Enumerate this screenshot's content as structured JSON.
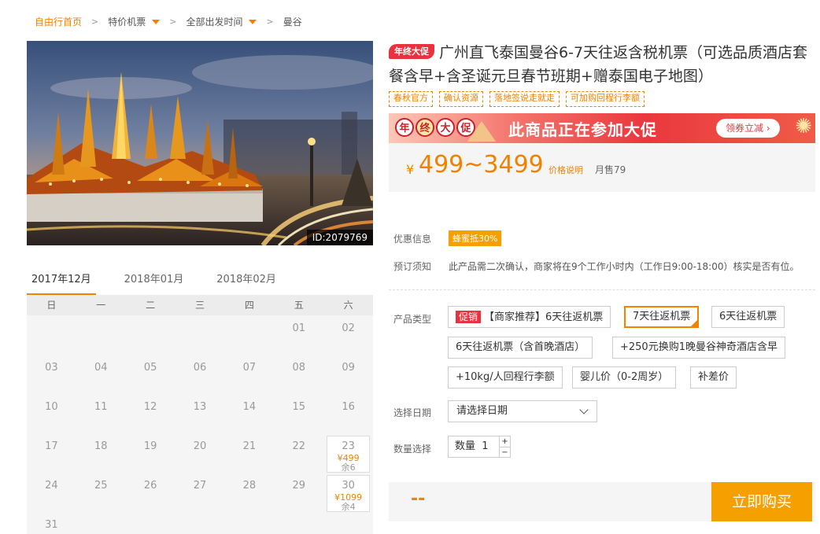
{
  "breadcrumb": {
    "home": "自由行首页",
    "items": [
      {
        "label": "特价机票",
        "dropdown": true
      },
      {
        "label": "全部出发时间",
        "dropdown": true
      },
      {
        "label": "曼谷",
        "dropdown": false
      }
    ]
  },
  "hero": {
    "image_id": "ID:2079769"
  },
  "calendar": {
    "months": [
      "2017年12月",
      "2018年01月",
      "2018年02月"
    ],
    "active_month_index": 0,
    "weekdays": [
      "日",
      "一",
      "二",
      "三",
      "四",
      "五",
      "六"
    ],
    "weeks": [
      [
        {
          "d": ""
        },
        {
          "d": ""
        },
        {
          "d": ""
        },
        {
          "d": ""
        },
        {
          "d": ""
        },
        {
          "d": "01"
        },
        {
          "d": "02"
        }
      ],
      [
        {
          "d": "03"
        },
        {
          "d": "04"
        },
        {
          "d": "05"
        },
        {
          "d": "06"
        },
        {
          "d": "07"
        },
        {
          "d": "08"
        },
        {
          "d": "09"
        }
      ],
      [
        {
          "d": "10"
        },
        {
          "d": "11"
        },
        {
          "d": "12"
        },
        {
          "d": "13"
        },
        {
          "d": "14"
        },
        {
          "d": "15"
        },
        {
          "d": "16"
        }
      ],
      [
        {
          "d": "17"
        },
        {
          "d": "18"
        },
        {
          "d": "19"
        },
        {
          "d": "20"
        },
        {
          "d": "21"
        },
        {
          "d": "22"
        },
        {
          "d": "23",
          "price": "¥499",
          "stock": "余6"
        }
      ],
      [
        {
          "d": "24"
        },
        {
          "d": "25"
        },
        {
          "d": "26"
        },
        {
          "d": "27"
        },
        {
          "d": "28"
        },
        {
          "d": "29"
        },
        {
          "d": "30",
          "price": "¥1099",
          "stock": "余4"
        }
      ],
      [
        {
          "d": "31"
        },
        {
          "d": ""
        },
        {
          "d": ""
        },
        {
          "d": ""
        },
        {
          "d": ""
        },
        {
          "d": ""
        },
        {
          "d": ""
        }
      ]
    ]
  },
  "product": {
    "promo_badge": "年终大促",
    "title": "广州直飞泰国曼谷6-7天往返含税机票（可选品质酒店套餐含早+含圣诞元旦春节班期+赠泰国电子地图）",
    "tags": [
      "春秋官方",
      "确认资源",
      "落地签说走就走",
      "可加购回程行李额"
    ],
    "banner": {
      "chars": [
        "年",
        "终",
        "大",
        "促"
      ],
      "text": "此商品正在参加大促",
      "coupon": "领券立减 ›"
    },
    "price": {
      "currency": "¥",
      "range": "499~3499",
      "desc_link": "价格说明",
      "sold": "月售79"
    }
  },
  "info": {
    "discount_label": "优惠信息",
    "discount": "蜂蜜抵30%",
    "notice_label": "预订须知",
    "notice": "此产品需二次确认，商家将在9个工作小时内（工作日9:00-18:00）核实是否有位。"
  },
  "options": {
    "label": "产品类型",
    "promo_tag": "促销",
    "items": [
      {
        "label": "【商家推荐】6天往返机票",
        "selected": false
      },
      {
        "label": "7天往返机票",
        "selected": true
      },
      {
        "label": "6天往返机票",
        "selected": false
      },
      {
        "label": "6天往返机票（含首晚酒店）",
        "selected": false
      },
      {
        "label": "+250元换购1晚曼谷神奇酒店含早",
        "selected": false
      },
      {
        "label": "+10kg/人回程行李额",
        "selected": false
      },
      {
        "label": "婴儿价（0-2周岁）",
        "selected": false
      },
      {
        "label": "补差价",
        "selected": false
      }
    ]
  },
  "date_select": {
    "label": "选择日期",
    "placeholder": "请选择日期"
  },
  "quantity": {
    "label": "数量选择",
    "prefix": "数量",
    "value": "1",
    "plus": "+",
    "minus": "−"
  },
  "buy": {
    "total": "--",
    "button": "立即购买"
  },
  "colors": {
    "accent": "#f08200",
    "buy": "#f5a000",
    "promo_red": "#e8333e"
  }
}
